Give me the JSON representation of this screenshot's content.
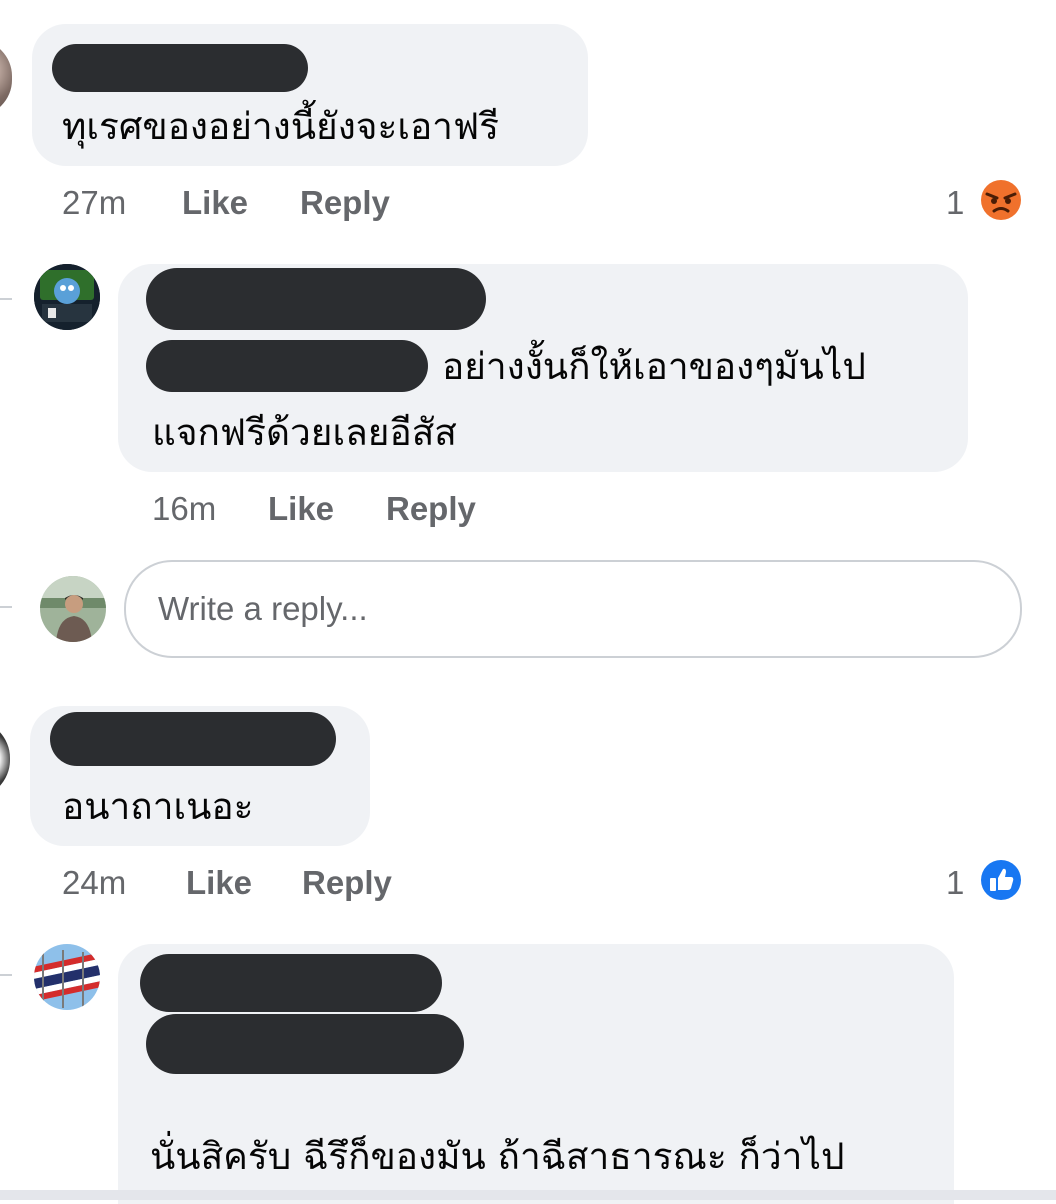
{
  "comments": [
    {
      "text": "ทุเรศของอย่างนี้ยังจะเอาฟรี",
      "time": "27m",
      "like_label": "Like",
      "reply_label": "Reply",
      "reaction_count": "1",
      "reaction_icon": "angry-reaction-icon"
    },
    {
      "text_line1": "อย่างงั้นก็ให้เอาของๆมันไป",
      "text_line2": "แจกฟรีด้วยเลยอีสัส",
      "time": "16m",
      "like_label": "Like",
      "reply_label": "Reply"
    },
    {
      "text": "อนาถาเนอะ",
      "time": "24m",
      "like_label": "Like",
      "reply_label": "Reply",
      "reaction_count": "1",
      "reaction_icon": "like-reaction-icon"
    },
    {
      "text": "นั่นสิครับ ฉีรึก็ของมัน ถ้าฉีสาธารณะ ก็ว่าไป"
    }
  ],
  "reply_input": {
    "placeholder": "Write a reply..."
  },
  "colors": {
    "bubble": "#f0f2f5",
    "redaction": "#2b2d30",
    "meta_text": "#65676b",
    "like_blue": "#1877f2",
    "angry_orange": "#f0712c"
  }
}
